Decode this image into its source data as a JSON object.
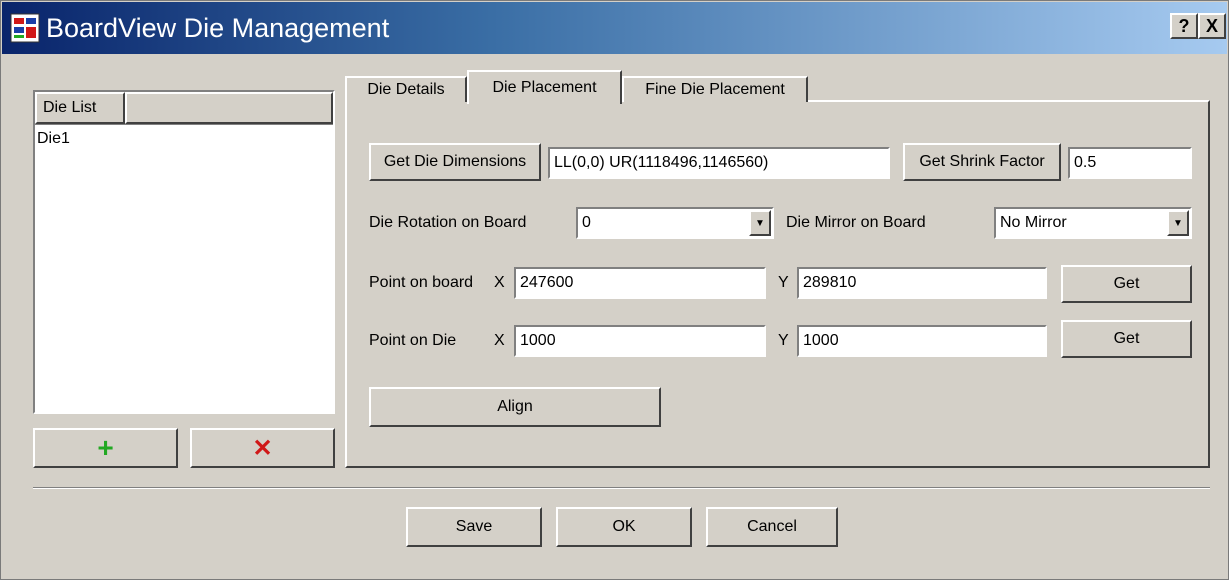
{
  "window": {
    "title": "BoardView Die Management",
    "help_label": "?",
    "close_label": "X"
  },
  "die_list": {
    "header": "Die List",
    "items": [
      "Die1"
    ],
    "add_label": "+",
    "remove_label": "✕"
  },
  "tabs": [
    {
      "label": "Die Details",
      "active": false
    },
    {
      "label": "Die Placement",
      "active": true
    },
    {
      "label": "Fine Die Placement",
      "active": false
    }
  ],
  "placement": {
    "get_dimensions_label": "Get Die Dimensions",
    "dimensions_value": "LL(0,0) UR(1118496,1146560)",
    "get_shrink_label": "Get Shrink Factor",
    "shrink_value": "0.5",
    "rotation_label": "Die Rotation on Board",
    "rotation_value": "0",
    "mirror_label": "Die Mirror on Board",
    "mirror_value": "No Mirror",
    "board_label": "Point on board",
    "board_x_label": "X",
    "board_x_value": "247600",
    "board_y_label": "Y",
    "board_y_value": "289810",
    "board_get_label": "Get",
    "die_label": "Point on Die",
    "die_x_label": "X",
    "die_x_value": "1000",
    "die_y_label": "Y",
    "die_y_value": "1000",
    "die_get_label": "Get",
    "align_label": "Align"
  },
  "footer": {
    "save_label": "Save",
    "ok_label": "OK",
    "cancel_label": "Cancel"
  },
  "colors": {
    "add": "#22a822",
    "remove": "#d01818",
    "face": "#d4d0c8"
  }
}
